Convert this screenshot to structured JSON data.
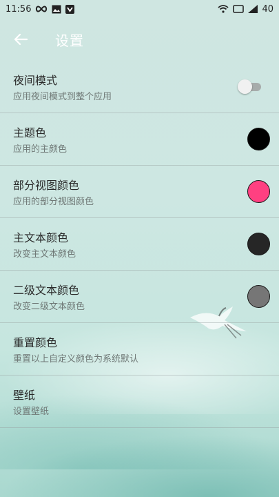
{
  "status_bar": {
    "time": "11:56",
    "left_icons": [
      "infinity-icon",
      "image-notification-icon",
      "shield-icon"
    ],
    "right_icons": [
      "wifi-icon",
      "screen-icon",
      "signal-icon"
    ],
    "battery_level": "40"
  },
  "app_bar": {
    "title": "设置",
    "back_icon": "arrow-left-icon"
  },
  "settings": [
    {
      "title": "夜间模式",
      "subtitle": "应用夜间模式到整个应用",
      "control": "toggle",
      "checked": false
    },
    {
      "title": "主题色",
      "subtitle": "应用的主颜色",
      "control": "color",
      "color": "#000000"
    },
    {
      "title": "部分视图颜色",
      "subtitle": "应用的部分视图颜色",
      "control": "color",
      "color": "#ff4081"
    },
    {
      "title": "主文本颜色",
      "subtitle": "改变主文本颜色",
      "control": "color",
      "color": "#262626"
    },
    {
      "title": "二级文本颜色",
      "subtitle": "改变二级文本颜色",
      "control": "color",
      "color": "#767676"
    },
    {
      "title": "重置颜色",
      "subtitle": "重置以上自定义颜色为系统默认",
      "control": "none"
    },
    {
      "title": "壁纸",
      "subtitle": "设置壁纸",
      "control": "none"
    }
  ],
  "colors": {
    "background": "#cde7e2",
    "title_text": "#ffffff",
    "divider": "#9aa3a3"
  }
}
